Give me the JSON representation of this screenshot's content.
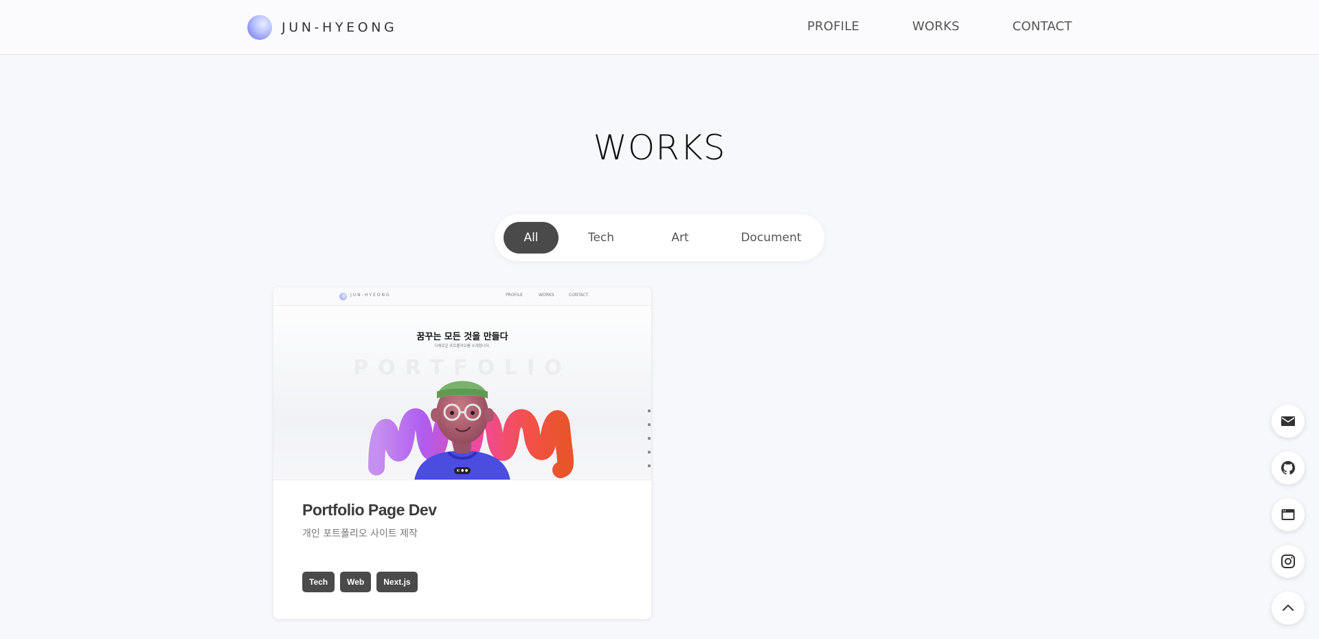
{
  "header": {
    "logo_text": "JUN-HYEONG",
    "nav": [
      "PROFILE",
      "WORKS",
      "CONTACT"
    ]
  },
  "works": {
    "title": "WORKS",
    "filters": [
      "All",
      "Tech",
      "Art",
      "Document"
    ],
    "active_filter": "All"
  },
  "cards": [
    {
      "title": "Portfolio Page Dev",
      "description": "개인 포트폴리오 사이트 제작",
      "tags": [
        "Tech",
        "Web",
        "Next.js"
      ],
      "thumbnail": {
        "logo_text": "JUN-HYEONG",
        "nav": [
          "PROFILE",
          "WORKS",
          "CONTACT"
        ],
        "headline": "꿈꾸는 모든 것을 만들다",
        "subline": "다채로운 포트폴리오를 소개합니다.",
        "big_word": "PORTFOLIO",
        "badge": "◐ ● ●"
      }
    }
  ],
  "floating_buttons": [
    "mail-icon",
    "github-icon",
    "browser-icon",
    "instagram-icon",
    "arrow-up-icon"
  ],
  "colors": {
    "background": "#f7f8fb",
    "accent_dark": "#4a4a4a",
    "logo_gradient": "#8c8ff2"
  }
}
